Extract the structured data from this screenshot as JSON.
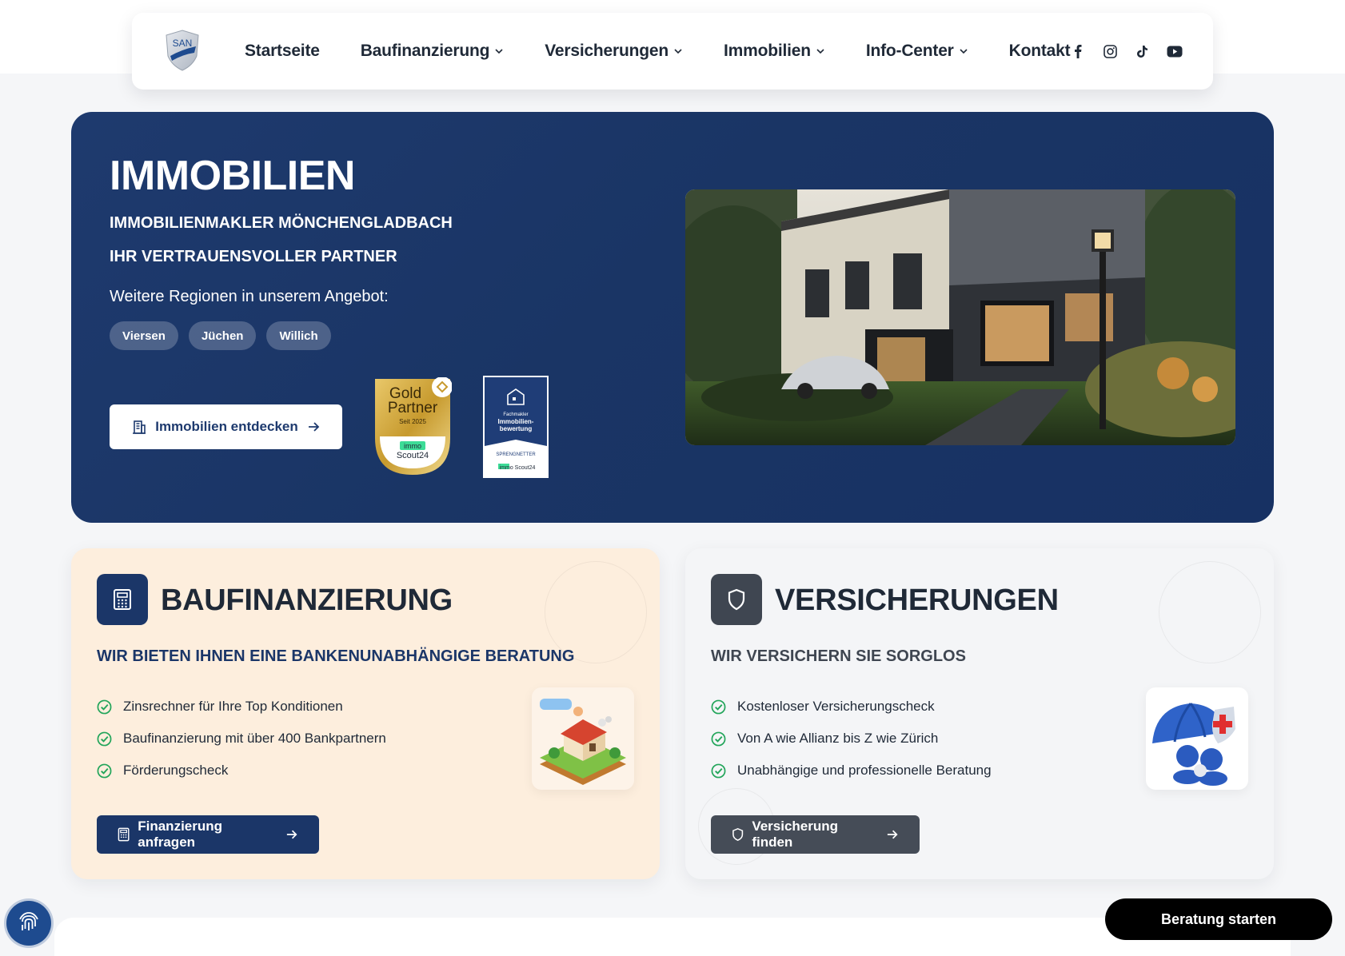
{
  "nav": {
    "logo_text": "SAN",
    "items": [
      {
        "label": "Startseite",
        "dropdown": false
      },
      {
        "label": "Baufinanzierung",
        "dropdown": true
      },
      {
        "label": "Versicherungen",
        "dropdown": true
      },
      {
        "label": "Immobilien",
        "dropdown": true
      },
      {
        "label": "Info-Center",
        "dropdown": true
      },
      {
        "label": "Kontakt",
        "dropdown": false
      }
    ],
    "social": [
      "facebook-icon",
      "instagram-icon",
      "tiktok-icon",
      "youtube-icon"
    ]
  },
  "hero": {
    "title": "IMMOBILIEN",
    "subtitle1": "IMMOBILIENMAKLER MÖNCHENGLADBACH",
    "subtitle2": "IHR VERTRAUENSVOLLER PARTNER",
    "regions_label": "Weitere Regionen in unserem Angebot:",
    "regions": [
      "Viersen",
      "Jüchen",
      "Willich"
    ],
    "cta_label": "Immobilien entdecken",
    "badge_gold": {
      "line1": "Gold",
      "line2": "Partner",
      "since": "Seit 2025",
      "brand1": "immo",
      "brand2": "Scout24"
    },
    "badge_sprengnetter": {
      "line1": "Fachmakler",
      "line2": "Immobilien-",
      "line3": "bewertung",
      "brand": "SPRENGNETTER",
      "brand2": "immo Scout24"
    }
  },
  "cards": {
    "finanzierung": {
      "title": "BAUFINANZIERUNG",
      "subtitle": "WIR BIETEN IHNEN EINE BANKENUNABHÄNGIGE BERATUNG",
      "features": [
        "Zinsrechner für Ihre Top Konditionen",
        "Baufinanzierung mit über 400 Bankpartnern",
        "Förderungscheck"
      ],
      "button_label": "Finanzierung anfragen"
    },
    "versicherungen": {
      "title": "VERSICHERUNGEN",
      "subtitle": "WIR VERSICHERN SIE SORGLOS",
      "features": [
        "Kostenloser Versicherungscheck",
        "Von A wie Allianz bis Z wie Zürich",
        "Unabhängige und professionelle Beratung"
      ],
      "button_label": "Versicherung finden"
    }
  },
  "chat_button": "Beratung starten",
  "colors": {
    "navy": "#1e3a6e",
    "slate": "#3f4651",
    "check_green": "#22a55a",
    "peach": "#fdeedd"
  }
}
